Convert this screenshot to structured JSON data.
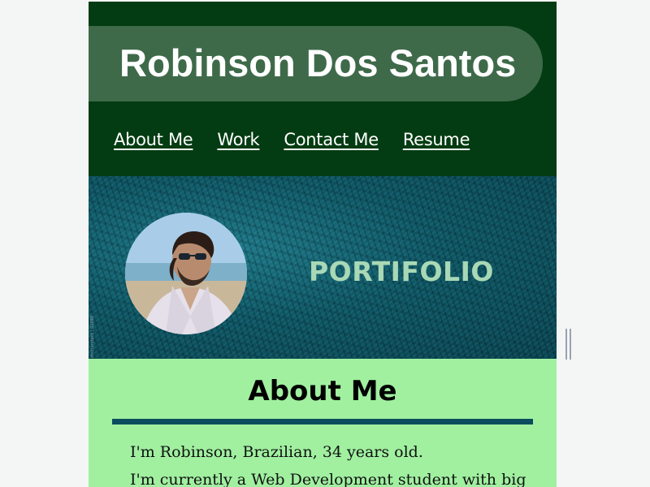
{
  "header": {
    "name": "Robinson Dos Santos",
    "nav": [
      {
        "label": "About Me"
      },
      {
        "label": "Work"
      },
      {
        "label": "Contact Me"
      },
      {
        "label": "Resume"
      }
    ]
  },
  "hero": {
    "title": "PORTIFOLIO",
    "watermark": "shutterstock | 92888"
  },
  "about": {
    "heading": "About Me",
    "line1": "I'm Robinson, Brazilian, 34 years old.",
    "line2": "I'm currently a Web Development student with big"
  },
  "colors": {
    "header_bg": "#033c12",
    "name_pill": "#3e6a4a",
    "about_bg": "#a0f0a0",
    "rule": "#0b4d5c",
    "hero_title": "#a8d8b5"
  }
}
